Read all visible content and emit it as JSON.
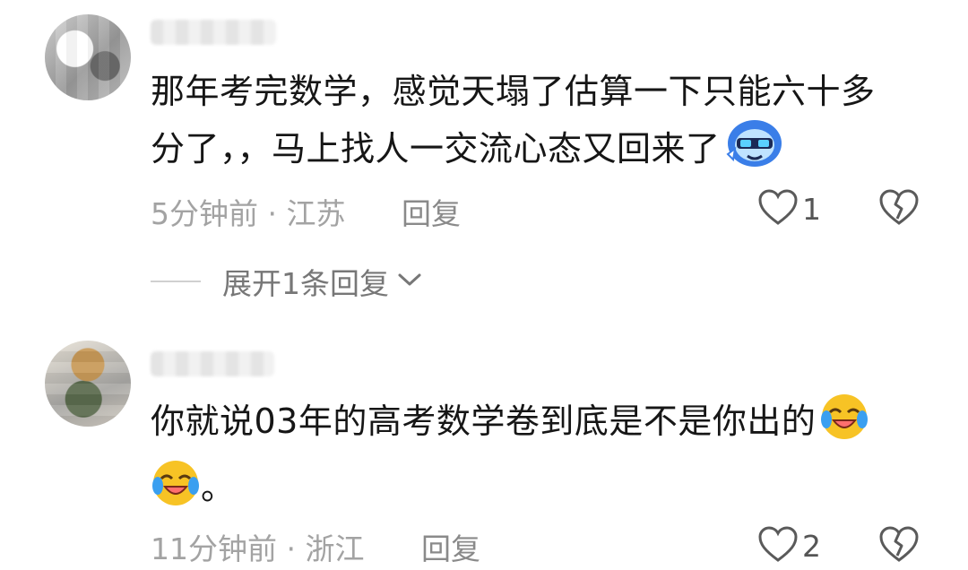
{
  "comments": [
    {
      "text_lines": [
        "那年考完数学，感觉天塌了估算一下只能六十多",
        "分了，，马上找人一交流心态又回来了"
      ],
      "time": "5分钟前",
      "location": "江苏",
      "separator": "·",
      "reply_label": "回复",
      "like_count": "1",
      "emoji": "blue-character-sticker"
    },
    {
      "text_lines": [
        "你就说03年的高考数学卷到底是不是你出的",
        "。"
      ],
      "time": "11分钟前",
      "location": "浙江",
      "separator": "·",
      "reply_label": "回复",
      "like_count": "2",
      "emoji": "rofl-face"
    }
  ],
  "expand_replies_label": "展开1条回复",
  "colors": {
    "text": "#161616",
    "meta": "#a3a3a3",
    "emoji_yellow": "#f7c325",
    "emoji_blue": "#3a7ee8"
  }
}
